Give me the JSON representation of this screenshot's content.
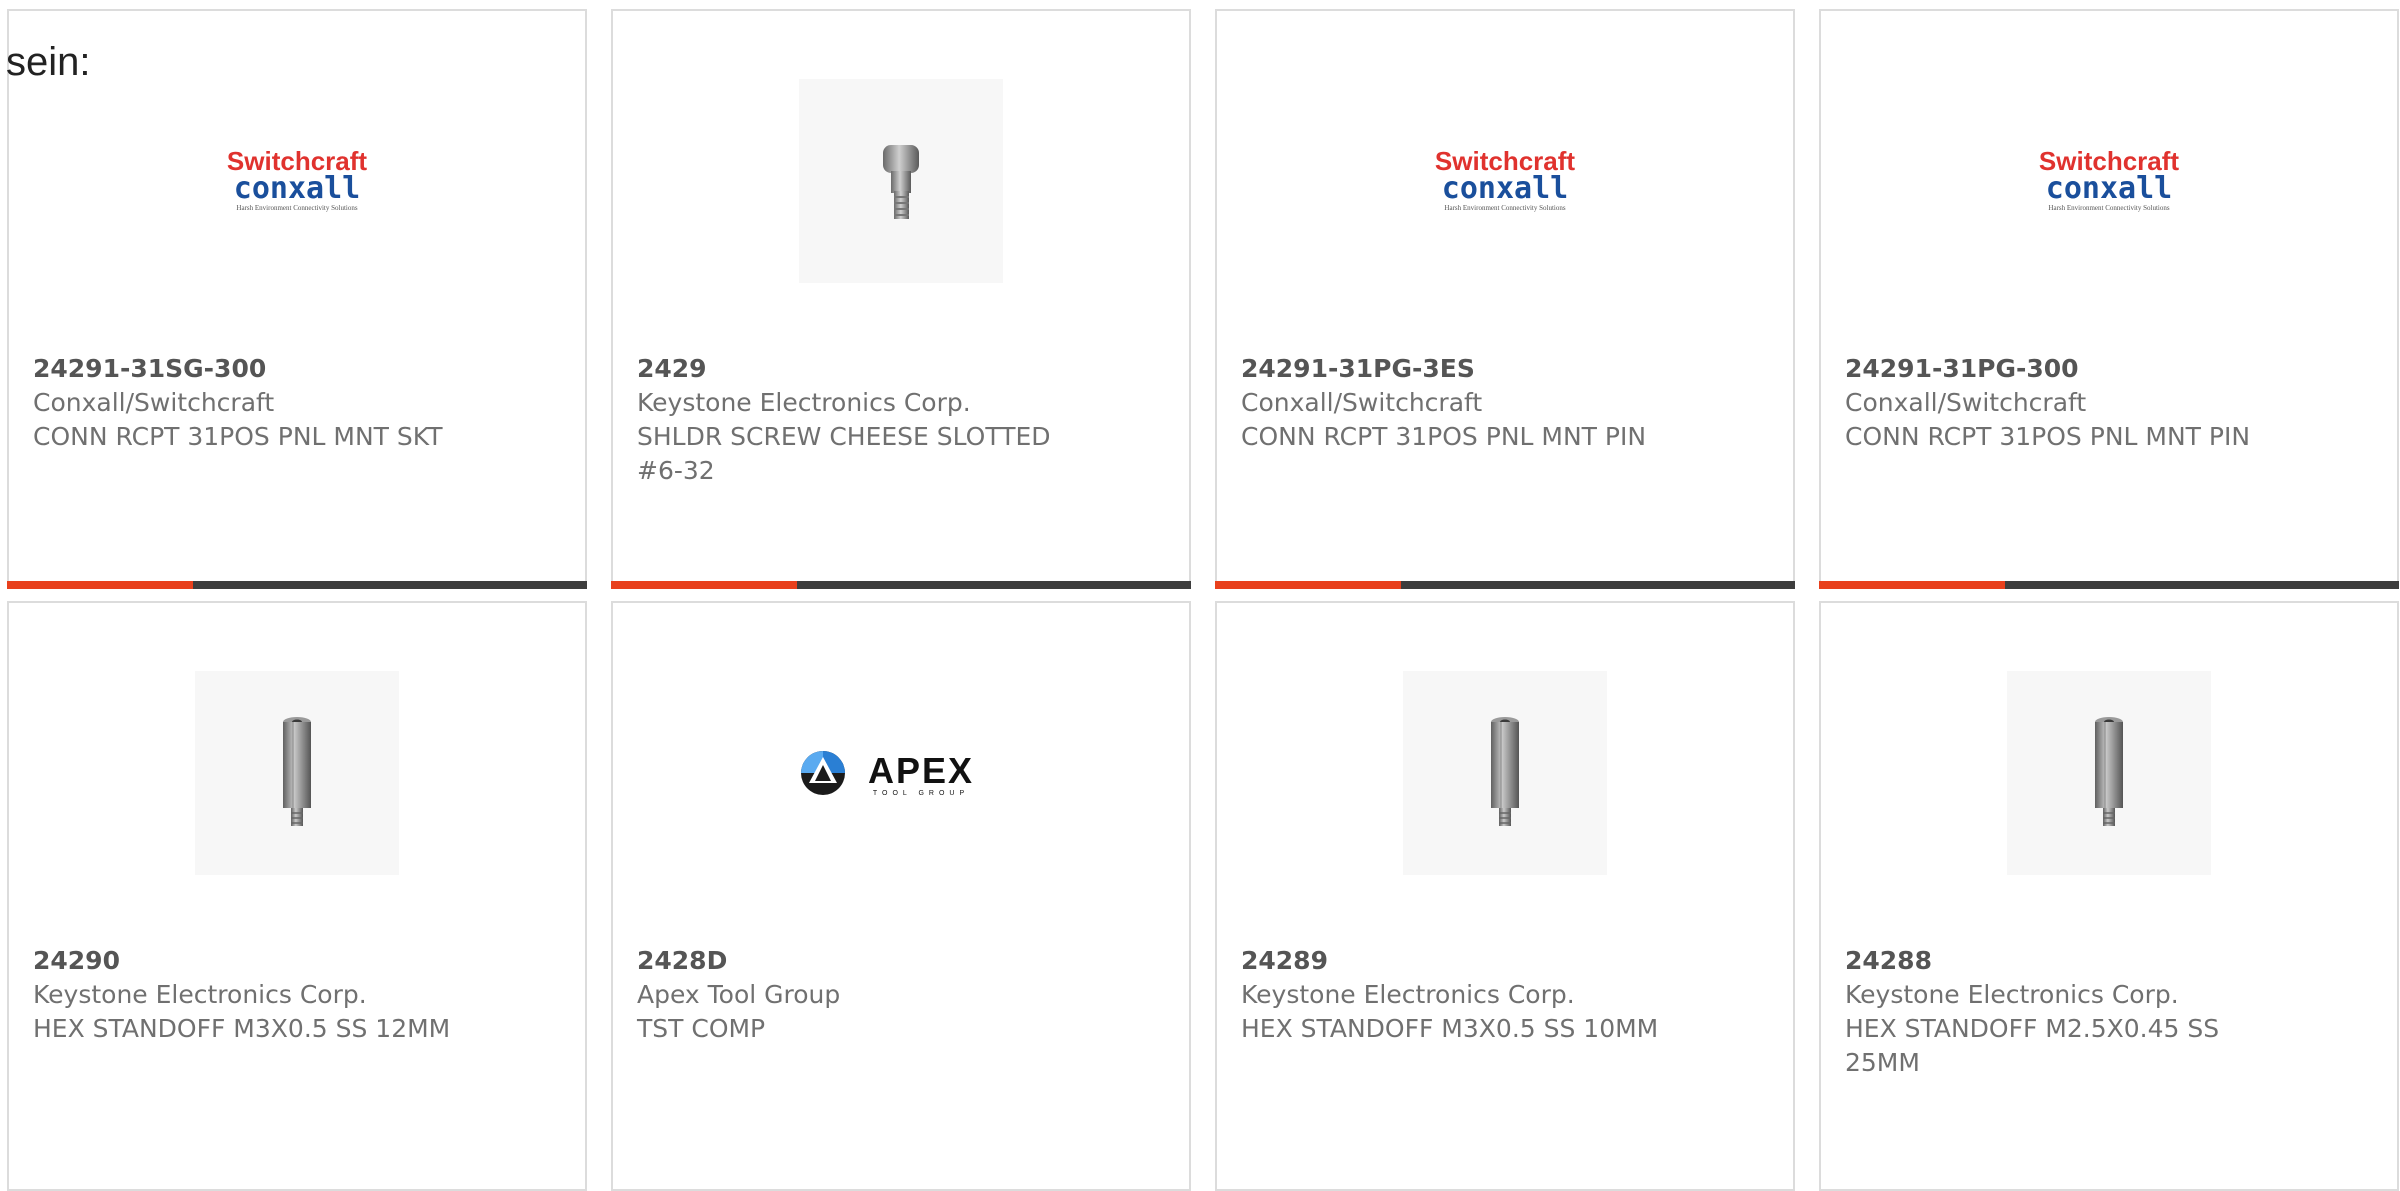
{
  "page": {
    "label": "sein:"
  },
  "colors": {
    "accent_bar": "#e8401c",
    "dark_bar": "#3d3d3d",
    "switchcraft_red": "#e0322e",
    "conxall_blue": "#1a4f9c",
    "apex_blue": "#2a7fd4"
  },
  "products": [
    {
      "part_number": "24291-31SG-300",
      "manufacturer": "Conxall/Switchcraft",
      "description": "CONN RCPT 31POS PNL MNT SKT",
      "image": "switchcraft-conxall-logo",
      "logo_top": "Switchcraft",
      "logo_bottom": "conxall",
      "logo_tagline": "Harsh Environment Connectivity Solutions",
      "progress": 0.32
    },
    {
      "part_number": "2429",
      "manufacturer": "Keystone Electronics Corp.",
      "description": "SHLDR SCREW CHEESE SLOTTED #6-32",
      "image": "shoulder-screw-photo",
      "progress": 0.32
    },
    {
      "part_number": "24291-31PG-3ES",
      "manufacturer": "Conxall/Switchcraft",
      "description": "CONN RCPT 31POS PNL MNT PIN",
      "image": "switchcraft-conxall-logo",
      "logo_top": "Switchcraft",
      "logo_bottom": "conxall",
      "logo_tagline": "Harsh Environment Connectivity Solutions",
      "progress": 0.32
    },
    {
      "part_number": "24291-31PG-300",
      "manufacturer": "Conxall/Switchcraft",
      "description": "CONN RCPT 31POS PNL MNT PIN",
      "image": "switchcraft-conxall-logo",
      "logo_top": "Switchcraft",
      "logo_bottom": "conxall",
      "logo_tagline": "Harsh Environment Connectivity Solutions",
      "progress": 0.32
    },
    {
      "part_number": "24290",
      "manufacturer": "Keystone Electronics Corp.",
      "description": "HEX STANDOFF M3X0.5 SS 12MM",
      "image": "hex-standoff-photo"
    },
    {
      "part_number": "2428D",
      "manufacturer": "Apex Tool Group",
      "description": "TST COMP",
      "image": "apex-tool-group-logo",
      "logo_top": "APEX",
      "logo_bottom": "TOOL GROUP"
    },
    {
      "part_number": "24289",
      "manufacturer": "Keystone Electronics Corp.",
      "description": "HEX STANDOFF M3X0.5 SS 10MM",
      "image": "hex-standoff-photo"
    },
    {
      "part_number": "24288",
      "manufacturer": "Keystone Electronics Corp.",
      "description": "HEX STANDOFF M2.5X0.45 SS 25MM",
      "image": "hex-standoff-photo"
    }
  ]
}
